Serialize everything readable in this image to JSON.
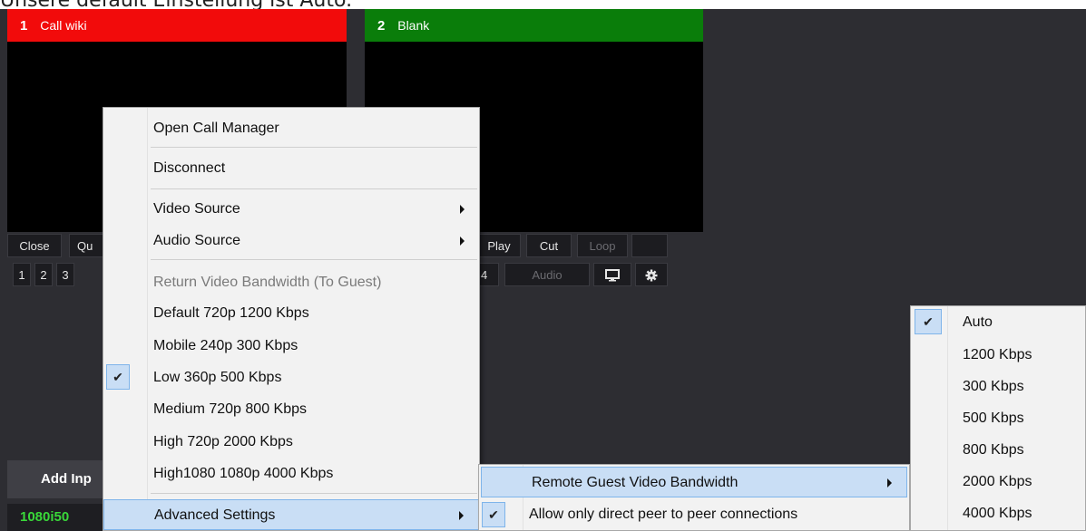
{
  "caption": "Unsere default Einstellung ist Auto.",
  "tiles": [
    {
      "number": "1",
      "name": "Call wiki"
    },
    {
      "number": "2",
      "name": "Blank"
    }
  ],
  "tile1_controls": {
    "close": "Close",
    "quick": "Qu",
    "nums": [
      "1",
      "2",
      "3"
    ]
  },
  "tile2_controls": {
    "play": "Play",
    "cut": "Cut",
    "loop": "Loop",
    "num4": "4",
    "audio": "Audio"
  },
  "add_input_label": "Add Inp",
  "format_label": "1080i50",
  "context_menu": {
    "open_call_manager": "Open Call Manager",
    "disconnect": "Disconnect",
    "video_source": "Video Source",
    "audio_source": "Audio Source",
    "return_header": "Return Video Bandwidth (To Guest)",
    "bandwidth_options": [
      {
        "label": "Default 720p 1200 Kbps",
        "checked": false
      },
      {
        "label": "Mobile 240p 300 Kbps",
        "checked": false
      },
      {
        "label": "Low 360p 500 Kbps",
        "checked": true
      },
      {
        "label": "Medium 720p 800 Kbps",
        "checked": false
      },
      {
        "label": "High 720p 2000 Kbps",
        "checked": false
      },
      {
        "label": "High1080 1080p 4000 Kbps",
        "checked": false
      }
    ],
    "advanced_settings": "Advanced Settings"
  },
  "advanced_submenu": {
    "remote_guest_bandwidth": "Remote Guest Video Bandwidth",
    "direct_p2p": "Allow only direct peer to peer connections",
    "direct_p2p_checked": true
  },
  "bandwidth_submenu": {
    "options": [
      {
        "label": "Auto",
        "checked": true
      },
      {
        "label": "1200 Kbps",
        "checked": false
      },
      {
        "label": "300 Kbps",
        "checked": false
      },
      {
        "label": "500 Kbps",
        "checked": false
      },
      {
        "label": "800 Kbps",
        "checked": false
      },
      {
        "label": "2000 Kbps",
        "checked": false
      },
      {
        "label": "4000 Kbps",
        "checked": false
      }
    ]
  },
  "colors": {
    "tile1_header": "#f20b0b",
    "tile2_header": "#0a7d0a",
    "format_text": "#39d839",
    "menu_highlight": "#c9def5"
  },
  "icons": {
    "check": "✔"
  }
}
